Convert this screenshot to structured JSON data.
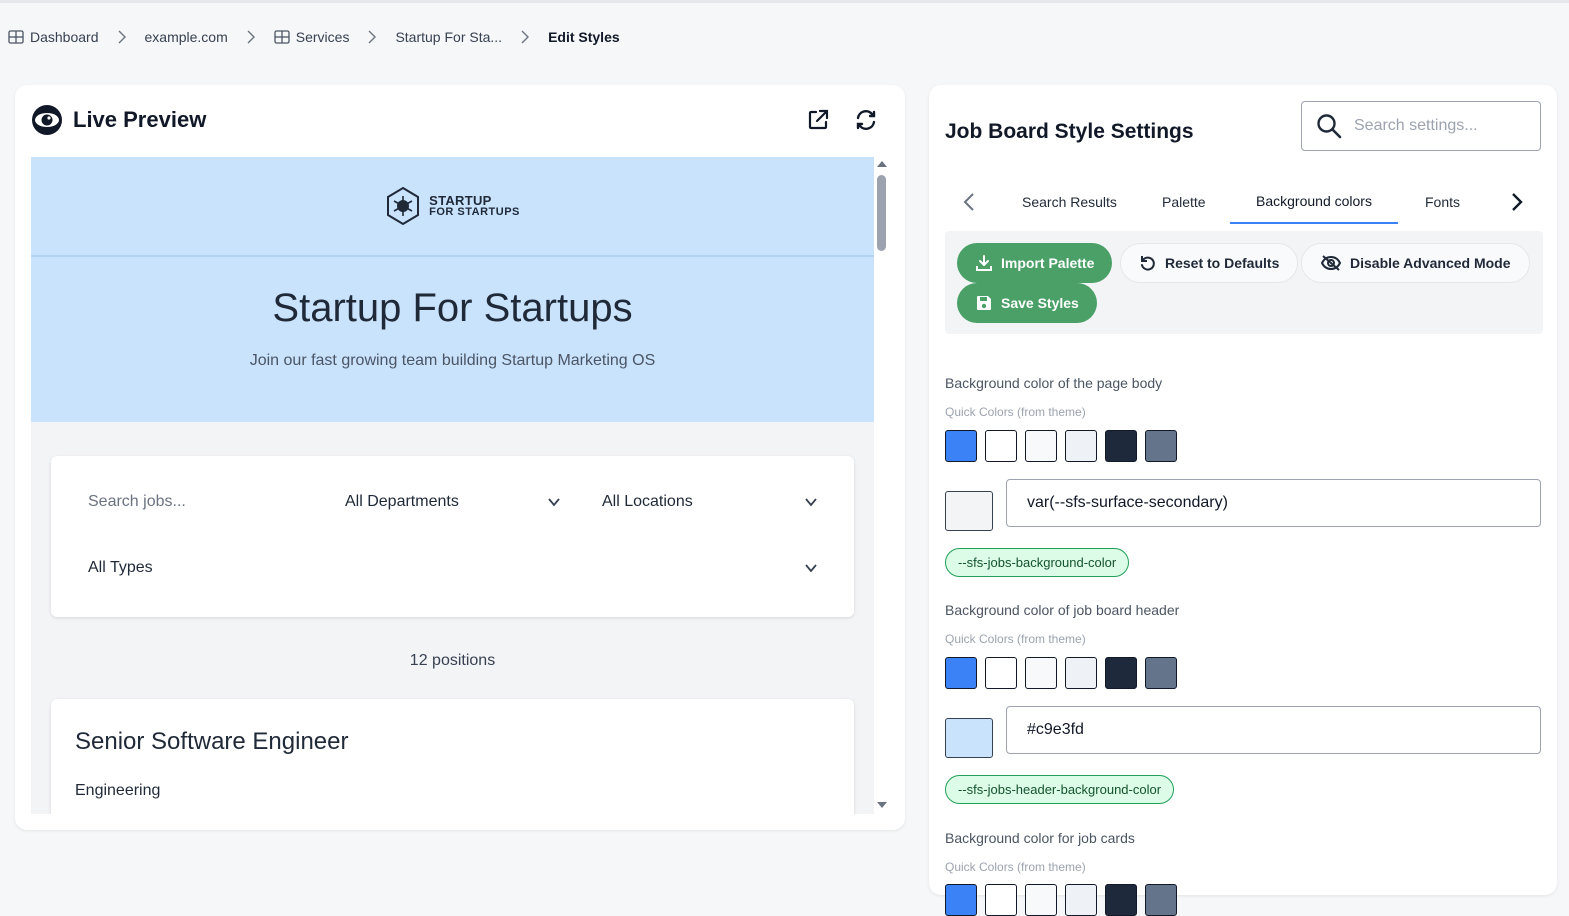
{
  "breadcrumb": {
    "items": [
      {
        "label": "Dashboard",
        "icon": "grid-icon"
      },
      {
        "label": "example.com"
      },
      {
        "label": "Services",
        "icon": "grid-icon"
      },
      {
        "label": "Startup For Sta..."
      },
      {
        "label": "Edit Styles"
      }
    ]
  },
  "preview": {
    "title": "Live Preview",
    "icons": [
      "eye-icon",
      "external-link-icon",
      "refresh-icon"
    ],
    "job_board": {
      "logo_line1": "STARTUP",
      "logo_line2": "FOR STARTUPS",
      "title": "Startup For Startups",
      "subtitle": "Join our fast growing team building Startup Marketing OS",
      "search_placeholder": "Search jobs...",
      "department_select": "All Departments",
      "location_select": "All Locations",
      "type_select": "All Types",
      "positions_count": "12 positions",
      "job": {
        "title": "Senior Software Engineer",
        "department": "Engineering"
      }
    }
  },
  "settings": {
    "title": "Job Board Style Settings",
    "search_placeholder": "Search settings...",
    "tabs": [
      "Search Results",
      "Palette",
      "Background colors",
      "Fonts"
    ],
    "active_tab": "Background colors",
    "toolbar": {
      "import": "Import Palette",
      "reset": "Reset to Defaults",
      "disable": "Disable Advanced Mode",
      "save": "Save Styles"
    },
    "quick_colors_label": "Quick Colors (from theme)",
    "theme_colors": [
      "#3b82f6",
      "#ffffff",
      "#f8f9fb",
      "#eef1f5",
      "#1e293b",
      "#64748b"
    ],
    "fields": [
      {
        "label": "Background color of the page body",
        "value": "var(--sfs-surface-secondary)",
        "preview_color": "#f3f4f6",
        "variable": "--sfs-jobs-background-color"
      },
      {
        "label": "Background color of job board header",
        "value": "#c9e3fd",
        "preview_color": "#c9e3fd",
        "variable": "--sfs-jobs-header-background-color"
      },
      {
        "label": "Background color for job cards"
      }
    ]
  },
  "colors": {
    "accent_green": "#4aa067",
    "active_tab_underline": "#3b82f6",
    "header_bg": "#c9e3fd"
  }
}
